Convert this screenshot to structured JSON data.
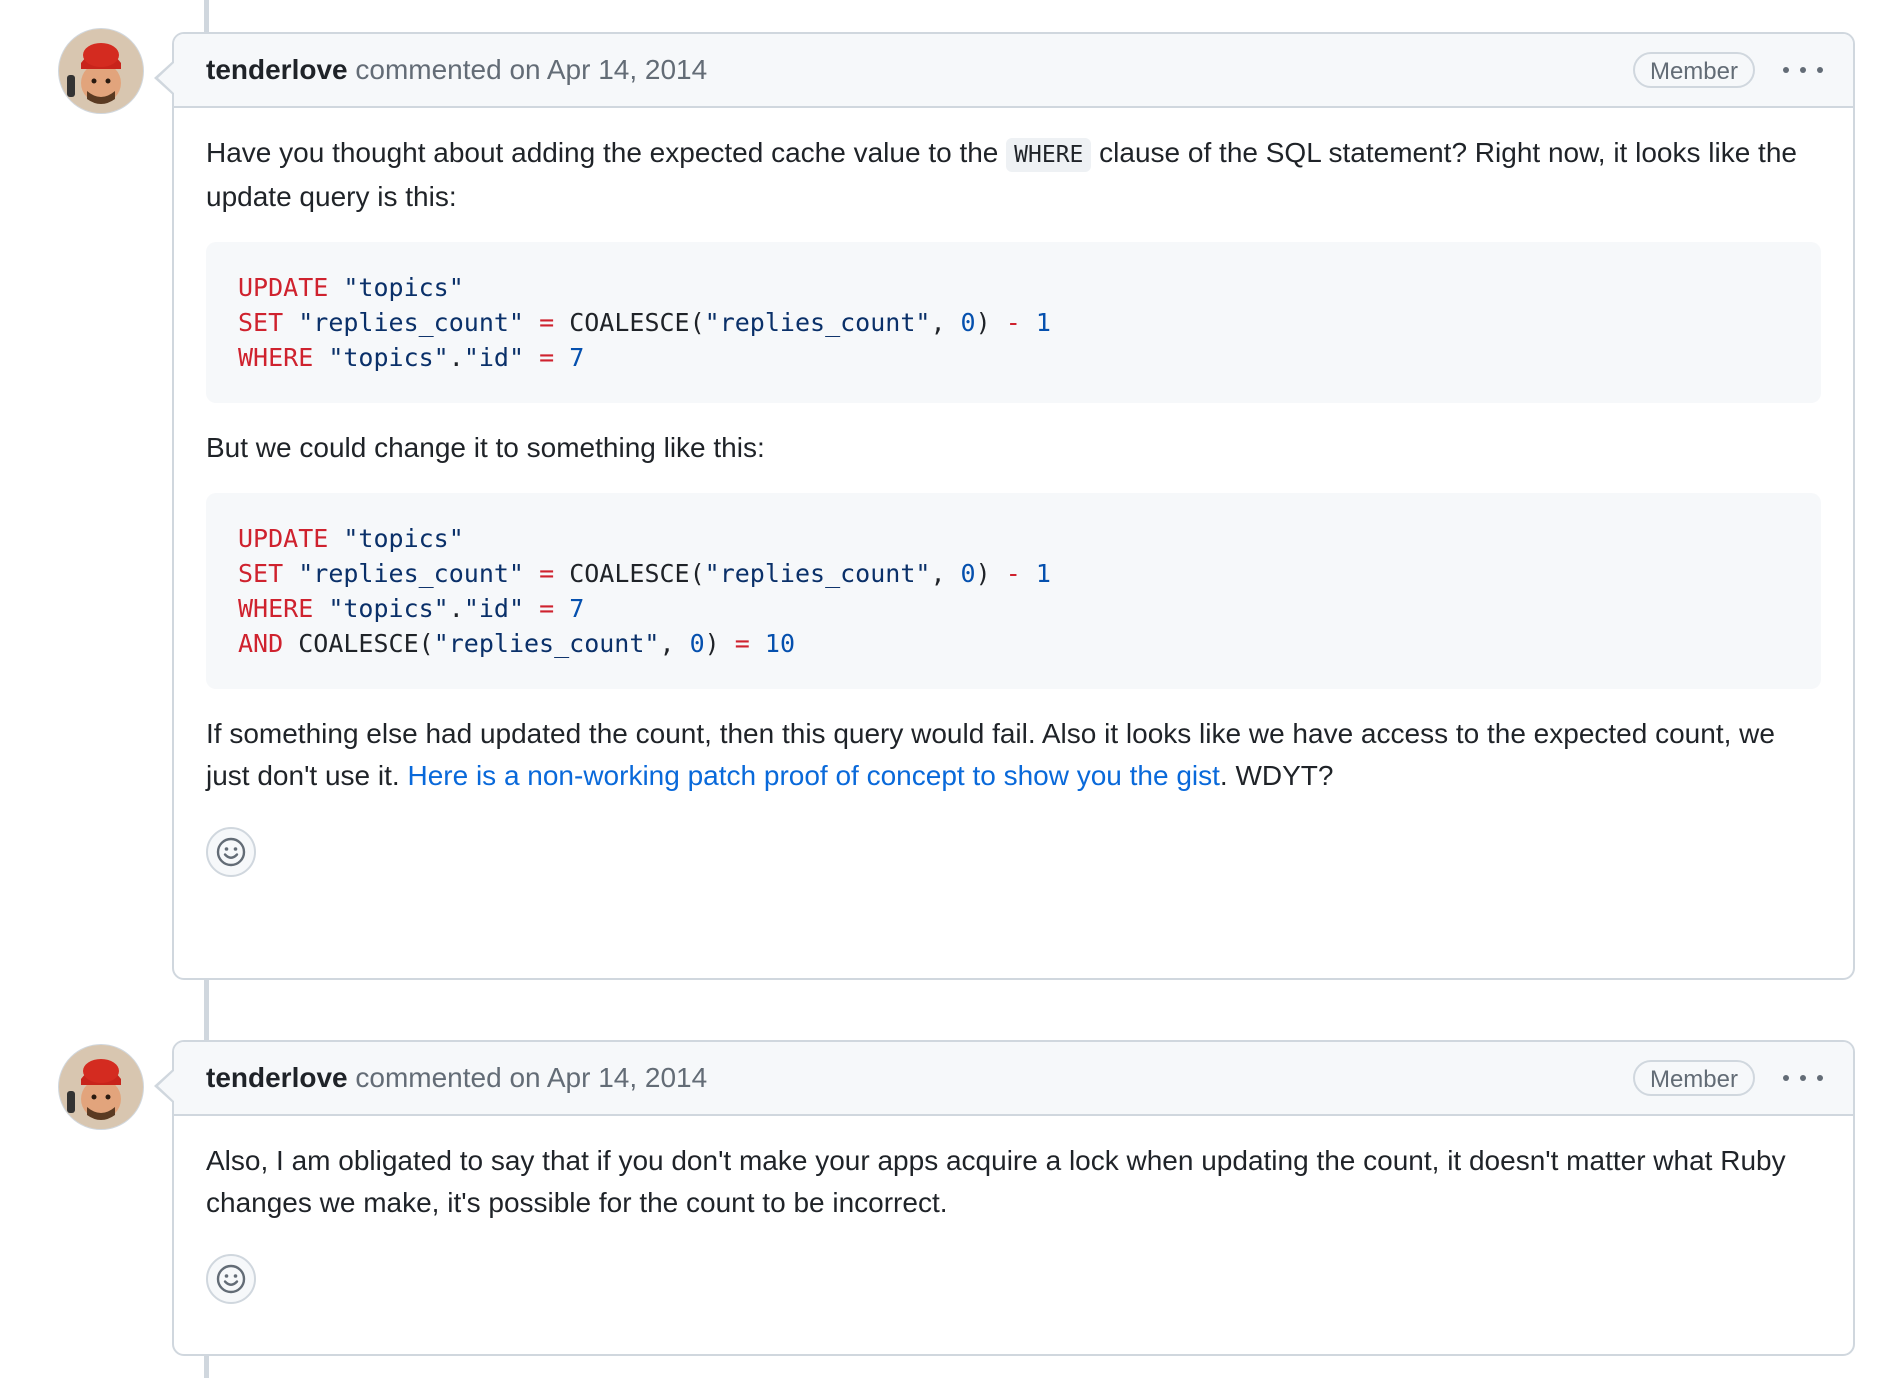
{
  "comments": [
    {
      "author": "tenderlove",
      "action": "commented on",
      "date": "Apr 14, 2014",
      "badge": "Member",
      "para1": {
        "before": "Have you thought about adding the expected cache value to the ",
        "code": "WHERE",
        "after": " clause of the SQL statement? Right now, it looks like the update query is this:"
      },
      "code1": {
        "line1": {
          "kw": "UPDATE",
          "tbl": "\"topics\""
        },
        "line2": {
          "kw": "SET",
          "col": "\"replies_count\"",
          "eq": "=",
          "fn": "COALESCE(",
          "arg": "\"replies_count\"",
          "comma": ", ",
          "zero": "0",
          "close": ")",
          "minus": "-",
          "one": "1"
        },
        "line3": {
          "kw": "WHERE",
          "tbl": "\"topics\"",
          "dot": ".",
          "col": "\"id\"",
          "eq": "=",
          "val": "7"
        }
      },
      "para2": "But we could change it to something like this:",
      "code2": {
        "line1": {
          "kw": "UPDATE",
          "tbl": "\"topics\""
        },
        "line2": {
          "kw": "SET",
          "col": "\"replies_count\"",
          "eq": "=",
          "fn": "COALESCE(",
          "arg": "\"replies_count\"",
          "comma": ", ",
          "zero": "0",
          "close": ")",
          "minus": "-",
          "one": "1"
        },
        "line3": {
          "kw": "WHERE",
          "tbl": "\"topics\"",
          "dot": ".",
          "col": "\"id\"",
          "eq": "=",
          "val": "7"
        },
        "line4": {
          "kw": "AND",
          "fn": "COALESCE(",
          "arg": "\"replies_count\"",
          "comma": ", ",
          "zero": "0",
          "close": ")",
          "eq": "=",
          "val": "10"
        }
      },
      "para3": {
        "before": "If something else had updated the count, then this query would fail. Also it looks like we have access to the expected count, we just don't use it. ",
        "link": "Here is a non-working patch proof of concept to show you the gist",
        "after": ". WDYT?"
      },
      "reaction_icon": "smiley-icon"
    },
    {
      "author": "tenderlove",
      "action": "commented on",
      "date": "Apr 14, 2014",
      "badge": "Member",
      "body": "Also, I am obligated to say that if you don't make your apps acquire a lock when updating the count, it doesn't matter what Ruby changes we make, it's possible for the count to be incorrect.",
      "reaction_icon": "smiley-icon"
    }
  ]
}
